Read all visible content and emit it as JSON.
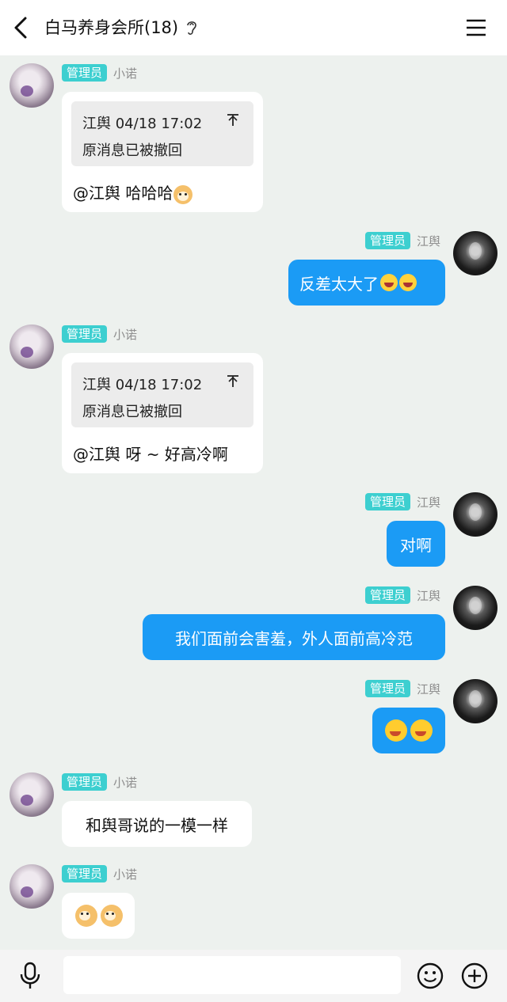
{
  "header": {
    "title": "白马养身会所(18)",
    "icons": [
      "back-arrow-icon",
      "ear-icon",
      "menu-icon"
    ]
  },
  "messages": [
    {
      "side": "in",
      "badge": "管理员",
      "sender": "小诺",
      "quote": {
        "author_time": "江舆 04/18 17:02",
        "text": "原消息已被撤回"
      },
      "text": "@江舆 哈哈哈",
      "emoji": [
        "shiba-dog-emoji"
      ]
    },
    {
      "side": "out",
      "badge": "管理员",
      "sender": "江舆",
      "text": "反差太大了",
      "emoji": [
        "laughing-tears-emoji",
        "laughing-tears-emoji"
      ]
    },
    {
      "side": "in",
      "badge": "管理员",
      "sender": "小诺",
      "quote": {
        "author_time": "江舆 04/18 17:02",
        "text": "原消息已被撤回"
      },
      "text": "@江舆 呀 ~ 好高冷啊"
    },
    {
      "side": "out",
      "badge": "管理员",
      "sender": "江舆",
      "text": "对啊"
    },
    {
      "side": "out",
      "badge": "管理员",
      "sender": "江舆",
      "text": "我们面前会害羞，外人面前高冷范"
    },
    {
      "side": "out",
      "badge": "管理员",
      "sender": "江舆",
      "text": "",
      "emoji": [
        "laughing-wink-emoji",
        "laughing-wink-emoji"
      ]
    },
    {
      "side": "in",
      "badge": "管理员",
      "sender": "小诺",
      "text": "和舆哥说的一模一样"
    },
    {
      "side": "in",
      "badge": "管理员",
      "sender": "小诺",
      "text": "",
      "emoji": [
        "shiba-dog-emoji",
        "shiba-dog-emoji"
      ]
    }
  ],
  "composer": {
    "input_value": "",
    "icons": [
      "microphone-icon",
      "emoji-smile-icon",
      "plus-circle-icon"
    ]
  },
  "colors": {
    "chat_background": "#edf1ee",
    "outgoing_bubble": "#1b9bf5",
    "incoming_bubble": "#ffffff",
    "admin_badge": "#3dcfd0"
  }
}
